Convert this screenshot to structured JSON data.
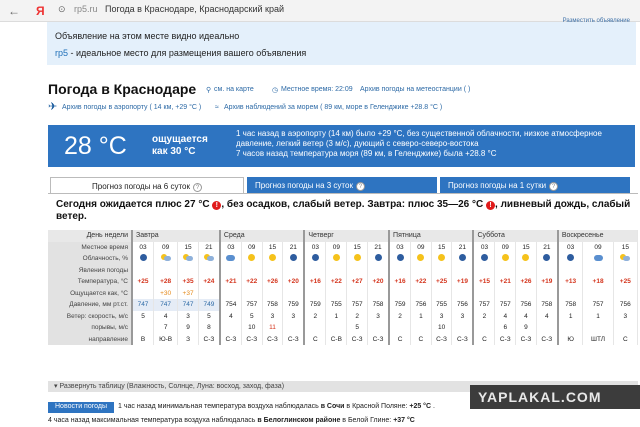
{
  "browser": {
    "url_domain": "rp5.ru",
    "url_title": "Погода в Краснодаре, Краснодарский край"
  },
  "ad": {
    "line1": "Объявление на этом месте видно идеально",
    "line2_link": "rp5",
    "line2_text": " - идеальное место для размещения вашего объявления",
    "show": "Разместить объявление"
  },
  "header": {
    "title": "Погода в Краснодаре",
    "map_link": "см. на карте",
    "local_time": "Местное время: 22:09",
    "meteo_archive": "Архив погоды на метеостанции ( )",
    "airport_archive": "Архив погоды в аэропорту ( 14 км, +29 °C )",
    "sea_archive": "Архив наблюдений за морем ( 89 км, море в Геленджике +28.8 °C )"
  },
  "banner": {
    "temp": "28 °C",
    "feels": "ощущается\nкак 30 °C",
    "info": "1 час назад в аэропорту (14 км) было +29 °C, без существенной облачности, низкое атмосферное давление, легкий ветер (3 м/с), дующий с северо-северо-востока\n7 часов назад температура моря (89 км, в Геленджике) была +28.8 °C"
  },
  "tabs": [
    "Прогноз погоды на 6 суток",
    "Прогноз погоды на 3 суток",
    "Прогноз погоды на 1 сутки"
  ],
  "forecast_headline": {
    "part1": "Сегодня ожидается плюс 27 °C",
    "part2": ", без осадков, слабый ветер. Завтра: плюс 35—26 °C",
    "part3": ", ливневый дождь, слабый ветер."
  },
  "table": {
    "row_labels": [
      "День недели",
      "Местное время",
      "Облачность, %",
      "Явления погоды",
      "Температура, °C",
      "Ощущается как, °C",
      "Давление, мм рт.ст.",
      "Ветер: скорость, м/с",
      "порывы, м/с",
      "направление"
    ],
    "days": [
      "Завтра",
      "Среда",
      "Четверг",
      "Пятница",
      "Суббота",
      "Воскресенье"
    ],
    "times": [
      "03",
      "09",
      "15",
      "21",
      "03",
      "09",
      "15",
      "21",
      "03",
      "09",
      "15",
      "21",
      "03",
      "09",
      "15",
      "21",
      "03",
      "09",
      "15",
      "21",
      "03",
      "09",
      "15"
    ],
    "clouds": [
      "moon",
      "pc",
      "pc",
      "pc",
      "cld",
      "sun",
      "sun",
      "moon",
      "moon",
      "sun",
      "sun",
      "moon",
      "moon",
      "sun",
      "sun",
      "moon",
      "moon",
      "sun",
      "sun",
      "moon",
      "moon",
      "cld",
      "pc"
    ],
    "temps": [
      "+25",
      "+28",
      "+35",
      "+24",
      "+21",
      "+22",
      "+26",
      "+20",
      "+16",
      "+22",
      "+27",
      "+20",
      "+16",
      "+22",
      "+25",
      "+19",
      "+15",
      "+21",
      "+26",
      "+19",
      "+13",
      "+18",
      "+25"
    ],
    "feels": [
      "",
      "+30",
      "+37",
      "",
      "",
      "",
      "",
      "",
      "",
      "",
      "",
      "",
      "",
      "",
      "",
      "",
      "",
      "",
      "",
      "",
      "",
      "",
      ""
    ],
    "pressure": [
      "747",
      "747",
      "747",
      "749",
      "754",
      "757",
      "758",
      "759",
      "759",
      "755",
      "757",
      "758",
      "759",
      "756",
      "755",
      "756",
      "757",
      "757",
      "756",
      "758",
      "758",
      "757",
      "756"
    ],
    "wind": [
      "5",
      "4",
      "3",
      "5",
      "4",
      "5",
      "3",
      "3",
      "2",
      "1",
      "2",
      "3",
      "2",
      "1",
      "3",
      "3",
      "2",
      "4",
      "4",
      "4",
      "1",
      "1",
      "3"
    ],
    "gusts": [
      "",
      "7",
      "9",
      "8",
      "",
      "10",
      "11",
      "",
      "",
      "",
      "5",
      "",
      "",
      "",
      "10",
      "",
      "",
      "6",
      "9",
      "",
      "",
      "",
      ""
    ],
    "direction": [
      "В",
      "Ю-В",
      "З",
      "С-З",
      "С-З",
      "С-З",
      "С-З",
      "С-З",
      "С",
      "С-В",
      "С-З",
      "С-З",
      "С",
      "С",
      "С-З",
      "С-З",
      "С",
      "С-З",
      "С-З",
      "С-З",
      "Ю",
      "ШТЛ",
      "С"
    ]
  },
  "expand": "Развернуть таблицу (Влажность, Солнце, Луна: восход, заход, фаза)",
  "news": {
    "tag": "Новости погоды",
    "item1_pre": "1 час назад минимальная температура воздуха наблюдалась ",
    "item1_b1": "в Сочи",
    "item1_mid": " в Красной Поляне: ",
    "item1_b2": "+25 °C",
    "item1_end": " .",
    "item2_pre": "4 часа назад максимальная температура воздуха наблюдалась ",
    "item2_b1": "в Белоглинском районе",
    "item2_mid": " в Белой Глине: ",
    "item2_b2": "+37 °C"
  },
  "watermark": "YAPLAKAL.COM"
}
